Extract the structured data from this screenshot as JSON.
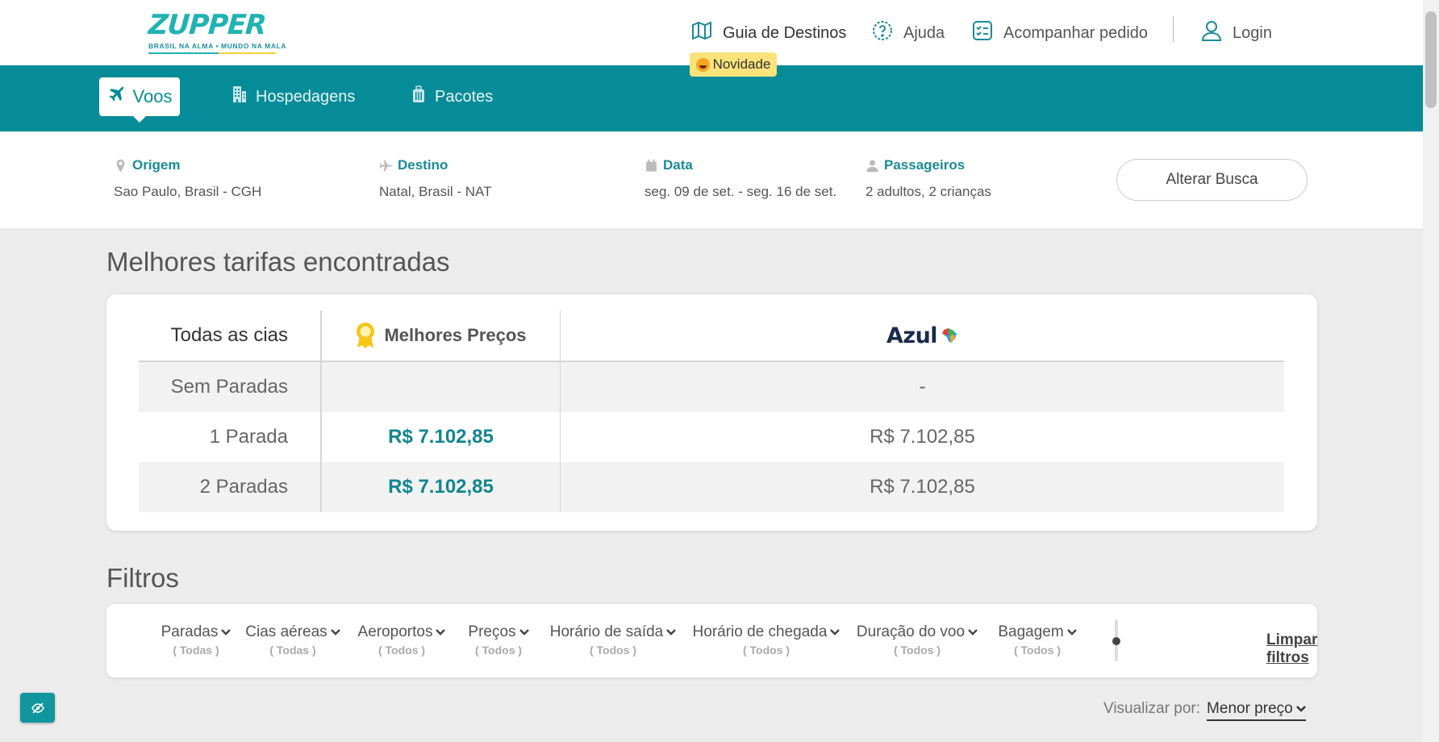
{
  "brand": {
    "name": "ZUPPER",
    "tagline": "BRASIL NA ALMA • MUNDO NA MALA"
  },
  "header": {
    "guia": "Guia de Destinos",
    "novidade": "Novidade",
    "ajuda": "Ajuda",
    "pedido": "Acompanhar pedido",
    "login": "Login"
  },
  "tabs": {
    "voos": "Voos",
    "hospedagens": "Hospedagens",
    "pacotes": "Pacotes"
  },
  "search": {
    "origem_label": "Origem",
    "origem": "Sao Paulo, Brasil - CGH",
    "destino_label": "Destino",
    "destino": "Natal, Brasil - NAT",
    "data_label": "Data",
    "data": "seg. 09 de set. - seg. 16 de set.",
    "passageiros_label": "Passageiros",
    "passageiros": "2 adultos, 2 crianças",
    "alterar": "Alterar Busca"
  },
  "best": {
    "title": "Melhores tarifas encontradas",
    "head_all": "Todas as cias",
    "head_best": "Melhores Preços",
    "head_airline": "Azul",
    "rows": [
      {
        "label": "Sem Paradas",
        "best": "",
        "azul": "-"
      },
      {
        "label": "1 Parada",
        "best": "R$ 7.102,85",
        "azul": "R$ 7.102,85"
      },
      {
        "label": "2 Paradas",
        "best": "R$ 7.102,85",
        "azul": "R$ 7.102,85"
      }
    ]
  },
  "filters": {
    "title": "Filtros",
    "items": [
      {
        "label": "Paradas",
        "sub": "( Todas )"
      },
      {
        "label": "Cias aéreas",
        "sub": "( Todas )"
      },
      {
        "label": "Aeroportos",
        "sub": "( Todos )"
      },
      {
        "label": "Preços",
        "sub": "( Todos )"
      },
      {
        "label": "Horário de saída",
        "sub": "( Todos )"
      },
      {
        "label": "Horário de chegada",
        "sub": "( Todos )"
      },
      {
        "label": "Duração do voo",
        "sub": "( Todos )"
      },
      {
        "label": "Bagagem",
        "sub": "( Todos )"
      }
    ],
    "clear": "Limpar filtros"
  },
  "sort": {
    "label": "Visualizar por:",
    "value": "Menor preço"
  },
  "colors": {
    "teal": "#068c99",
    "price": "#11868f",
    "badge": "#f9e37a"
  }
}
